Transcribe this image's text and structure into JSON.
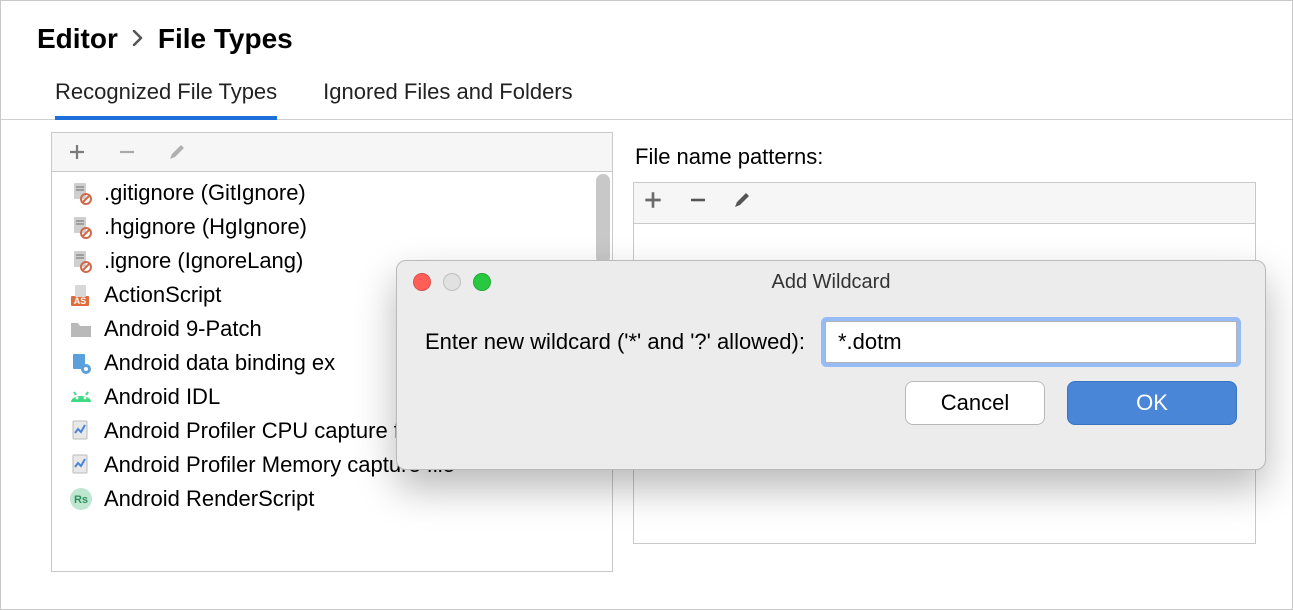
{
  "breadcrumb": {
    "parent": "Editor",
    "current": "File Types"
  },
  "tabs": {
    "recognized": "Recognized File Types",
    "ignored": "Ignored Files and Folders"
  },
  "filetypes": [
    {
      "icon": "file-ignore-icon",
      "label": ".gitignore (GitIgnore)"
    },
    {
      "icon": "file-ignore-icon",
      "label": ".hgignore (HgIgnore)"
    },
    {
      "icon": "file-ignore-icon",
      "label": ".ignore (IgnoreLang)"
    },
    {
      "icon": "actionscript-icon",
      "label": "ActionScript"
    },
    {
      "icon": "folder-icon",
      "label": "Android 9-Patch"
    },
    {
      "icon": "android-data-icon",
      "label": "Android data binding ex"
    },
    {
      "icon": "android-idl-icon",
      "label": "Android IDL"
    },
    {
      "icon": "profiler-icon",
      "label": "Android Profiler CPU capture file"
    },
    {
      "icon": "profiler-icon",
      "label": "Android Profiler Memory capture file"
    },
    {
      "icon": "renderscript-icon",
      "label": "Android RenderScript"
    }
  ],
  "patterns_label": "File name patterns:",
  "dialog": {
    "title": "Add Wildcard",
    "prompt": "Enter new wildcard ('*' and '?' allowed):",
    "value": "*.dotm",
    "cancel": "Cancel",
    "ok": "OK"
  }
}
